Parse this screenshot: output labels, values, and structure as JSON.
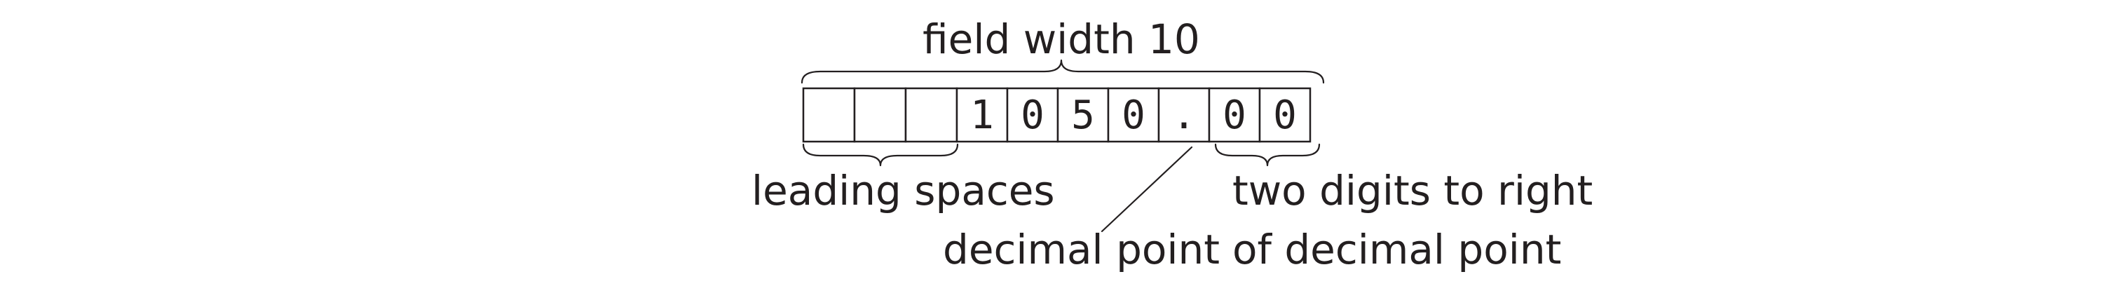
{
  "diagram": {
    "field_width_label": "field width 10",
    "cells": [
      "",
      "",
      "",
      "1",
      "0",
      "5",
      "0",
      ".",
      "0",
      "0"
    ],
    "leading_spaces_label": "leading spaces",
    "decimal_point_label": "decimal point",
    "right_digits_label_line1": "two digits to right",
    "right_digits_label_line2": "of decimal point",
    "ink_color": "#231f20"
  }
}
